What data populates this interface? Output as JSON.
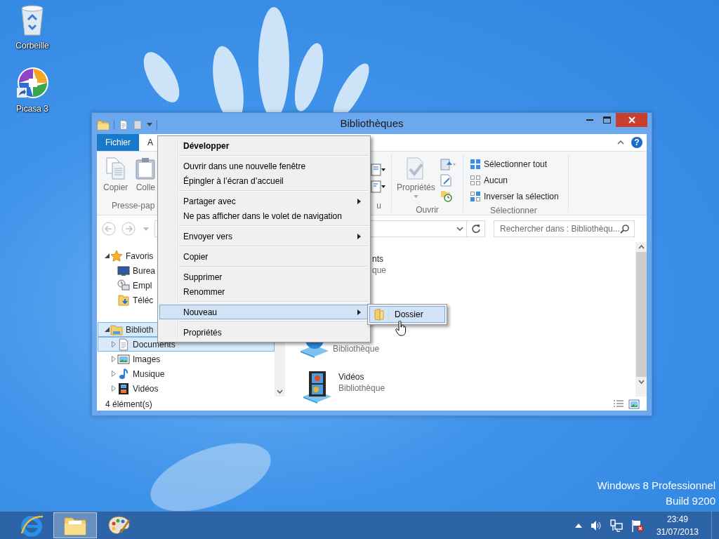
{
  "desktop_icons": [
    {
      "label": "Corbeille",
      "kind": "recycle-bin"
    },
    {
      "label": "Picasa 3",
      "kind": "photo-app"
    }
  ],
  "edition": [
    "Windows 8 Professionnel",
    "Build 9200"
  ],
  "window": {
    "title": "Bibliothèques",
    "ribbon_tabs": [
      {
        "label": "Fichier",
        "selected": true
      },
      {
        "label": "A",
        "selected": false
      }
    ],
    "help_button": "?",
    "ribbon": {
      "clipboard": {
        "buttons": [
          "Copier",
          "Colle"
        ],
        "label": "Presse-pap"
      },
      "organize": {
        "label": "u"
      },
      "open": {
        "button": "Propriétés",
        "label": "Ouvrir"
      },
      "select": {
        "items": [
          "Sélectionner tout",
          "Aucun",
          "Inverser la sélection"
        ],
        "label": "Sélectionner"
      }
    },
    "search": {
      "placeholder": "Rechercher dans : Bibliothèqu..."
    },
    "navigation": [
      {
        "label": "Favoris",
        "kind": "favorites",
        "expanded": true,
        "selected": false,
        "children": [
          {
            "label": "Burea",
            "kind": "desktop",
            "selected": false
          },
          {
            "label": "Empl",
            "kind": "recent",
            "selected": false
          },
          {
            "label": "Téléc",
            "kind": "downloads",
            "selected": false
          }
        ]
      },
      {
        "label": "Biblioth",
        "kind": "libraries",
        "expanded": true,
        "selected": true,
        "children": [
          {
            "label": "Documents",
            "kind": "documents",
            "expanded": false,
            "selected": true
          },
          {
            "label": "Images",
            "kind": "pictures",
            "expanded": false,
            "selected": false
          },
          {
            "label": "Musique",
            "kind": "music",
            "expanded": false,
            "selected": false
          },
          {
            "label": "Vidéos",
            "kind": "videos",
            "expanded": false,
            "selected": false
          }
        ]
      }
    ],
    "items": [
      {
        "name": "nts",
        "subtitle": "que"
      },
      {
        "subtitle": "Bibliothèque",
        "kind": "music"
      },
      {
        "name": "Vidéos",
        "subtitle": "Bibliothèque",
        "kind": "videos"
      }
    ],
    "status_bar": "4 élément(s)"
  },
  "context_menu": {
    "groups": [
      [
        {
          "label": "Développer",
          "default": true,
          "submenu": false,
          "selected": false
        }
      ],
      [
        {
          "label": "Ouvrir dans une nouvelle fenêtre",
          "default": false,
          "submenu": false,
          "selected": false
        },
        {
          "label": "Épingler à l’écran d’accueil",
          "default": false,
          "submenu": false,
          "selected": false
        }
      ],
      [
        {
          "label": "Partager avec",
          "default": false,
          "submenu": true,
          "selected": false
        },
        {
          "label": "Ne pas afficher dans le volet de navigation",
          "default": false,
          "submenu": false,
          "selected": false
        }
      ],
      [
        {
          "label": "Envoyer vers",
          "default": false,
          "submenu": true,
          "selected": false
        }
      ],
      [
        {
          "label": "Copier",
          "default": false,
          "submenu": false,
          "selected": false
        }
      ],
      [
        {
          "label": "Supprimer",
          "default": false,
          "submenu": false,
          "selected": false
        },
        {
          "label": "Renommer",
          "default": false,
          "submenu": false,
          "selected": false
        }
      ],
      [
        {
          "label": "Nouveau",
          "default": false,
          "submenu": true,
          "selected": true
        }
      ],
      [
        {
          "label": "Propriétés",
          "default": false,
          "submenu": false,
          "selected": false
        }
      ]
    ]
  },
  "submenu": [
    {
      "label": "Dossier",
      "selected": true
    }
  ],
  "taskbar": {
    "apps": [
      {
        "kind": "browser",
        "selected": false
      },
      {
        "kind": "explorer",
        "selected": true
      },
      {
        "kind": "paint",
        "selected": false
      }
    ],
    "time": "23:49",
    "date": "31/07/2013"
  }
}
